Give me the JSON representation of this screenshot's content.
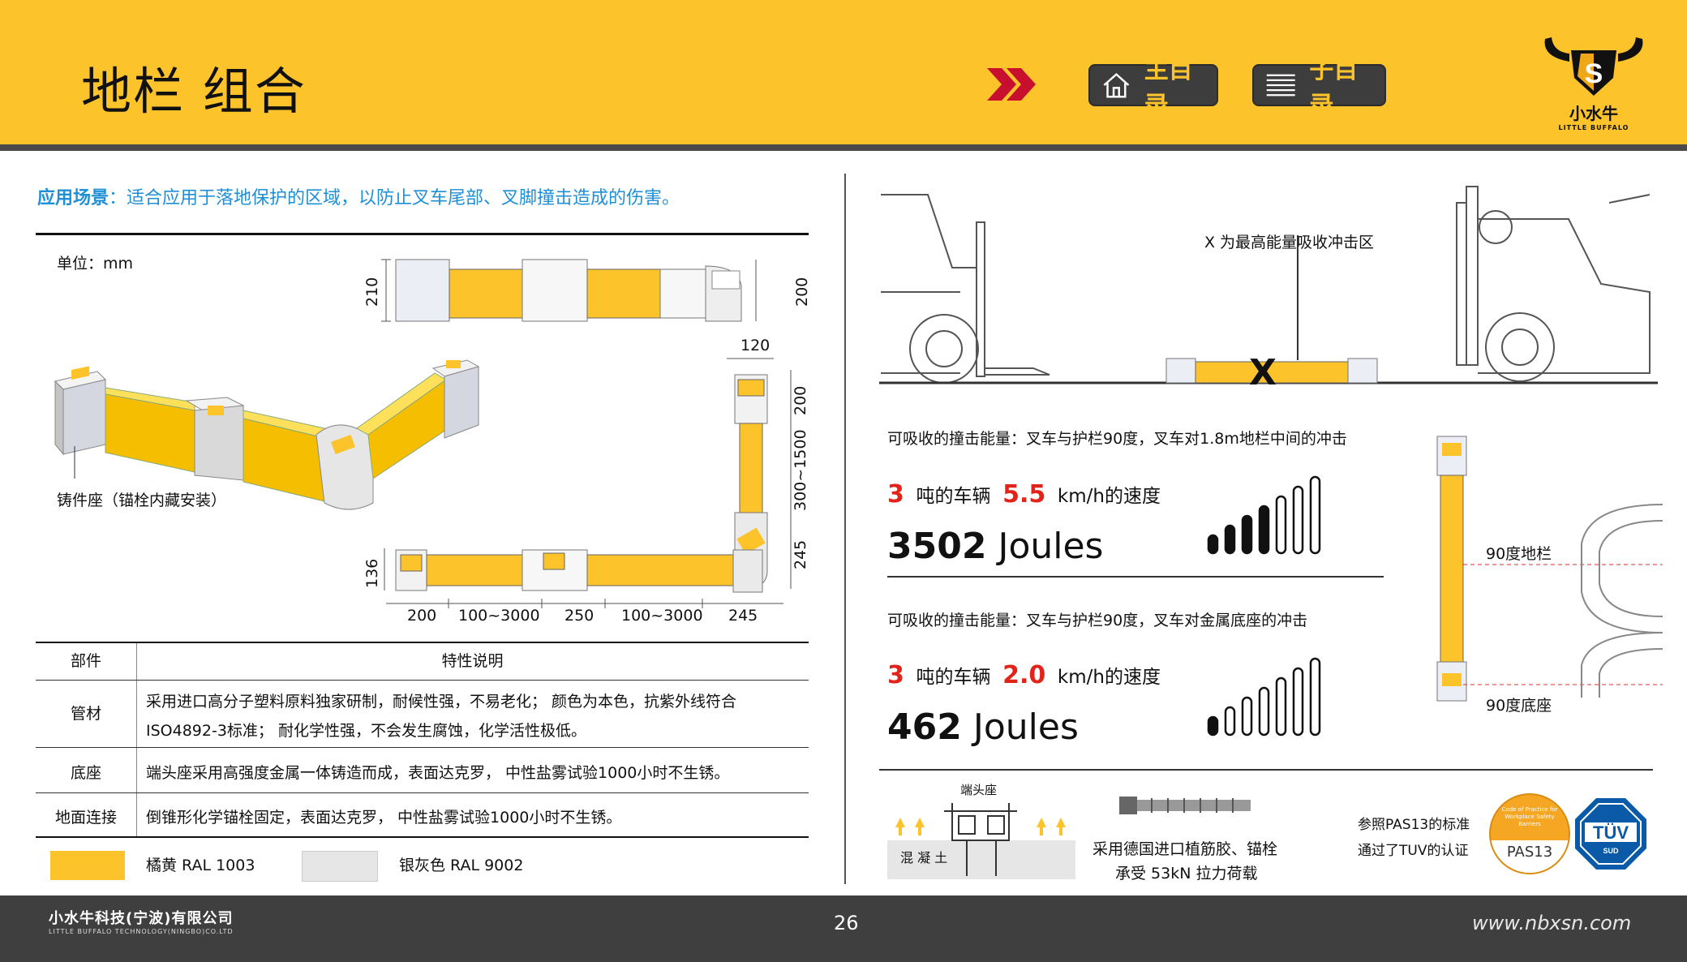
{
  "header": {
    "title": "地栏 组合",
    "nav_main_label": "主目录",
    "nav_sub_label": "子目录",
    "logo_letter": "S",
    "logo_cn": "小水牛",
    "logo_en": "LITTLE BUFFALO"
  },
  "left": {
    "app_label": "应用场景",
    "app_text": "：适合应用于落地保护的区域，以防止叉车尾部、叉脚撞击造成的伤害。",
    "unit": "单位：mm",
    "casting_label": "铸件座（锚栓内藏安装）",
    "dims": {
      "top_h_left": "210",
      "top_h_right": "200",
      "right_w": "120",
      "right_seg1": "200",
      "right_seg2": "300~1500",
      "right_seg3": "245",
      "bottom_h": "136",
      "bottom_seg": [
        "200",
        "100~3000",
        "250",
        "100~3000",
        "245"
      ]
    },
    "table": {
      "header": [
        "部件",
        "特性说明"
      ],
      "rows": [
        {
          "part": "管材",
          "desc1": "采用进口高分子塑料原料独家研制，耐候性强，不易老化；  颜色为本色，抗紫外线符合",
          "desc2": "ISO4892-3标准；  耐化学性强，不会发生腐蚀，化学活性极低。"
        },
        {
          "part": "底座",
          "desc1": "端头座采用高强度金属一体铸造而成，表面达克罗，  中性盐雾试验1000小时不生锈。",
          "desc2": ""
        },
        {
          "part": "地面连接",
          "desc1": "倒锥形化学锚栓固定，表面达克罗，  中性盐雾试验1000小时不生锈。",
          "desc2": ""
        }
      ]
    },
    "swatches": [
      {
        "name": "橘黄  RAL 1003",
        "color": "#fdc32a"
      },
      {
        "name": "银灰色  RAL 9002",
        "color": "#e6e6e6"
      }
    ]
  },
  "right": {
    "x_label": "X 为最高能量吸收冲击区",
    "x_mark": "X",
    "energy": [
      {
        "cond": "可吸收的撞击能量：叉车与护栏90度，叉车对1.8m地栏中间的冲击",
        "ton": "3",
        "ton_unit": "吨的车辆",
        "speed": "5.5",
        "speed_unit": "km/h的速度",
        "joules_num": "3502",
        "joules_unit": "Joules",
        "filled_bars": 4
      },
      {
        "cond": "可吸收的撞击能量：叉车与护栏90度，叉车对金属底座的冲击",
        "ton": "3",
        "ton_unit": "吨的车辆",
        "speed": "2.0",
        "speed_unit": "km/h的速度",
        "joules_num": "462",
        "joules_unit": "Joules",
        "filled_bars": 1
      }
    ],
    "side_labels": [
      "90度地栏",
      "90度底座"
    ],
    "bottom": {
      "end_seat": "端头座",
      "concrete": "混 凝 土",
      "anchor_line1": "采用德国进口植筋胶、锚栓",
      "anchor_line2": "承受 53kN 拉力荷载",
      "pas_line1": "参照PAS13的标准",
      "pas_line2": "通过了TUV的认证",
      "pas_badge": "PAS13",
      "pas_badge_small": "Code of Practice for Workplace Safety Barriers",
      "tuv_badge": "TÜV",
      "tuv_sub": "SUD"
    }
  },
  "footer": {
    "company": "小水牛科技(宁波)有限公司",
    "company_en": "LITTLE BUFFALO TECHNOLOGY(NINGBO)CO.LTD",
    "page_number": "26",
    "website": "www.nbxsn.com"
  },
  "colors": {
    "accent": "#fdc32a",
    "dark": "#3f3f3f",
    "link_blue": "#1f8fd6",
    "red": "#e2231a"
  }
}
